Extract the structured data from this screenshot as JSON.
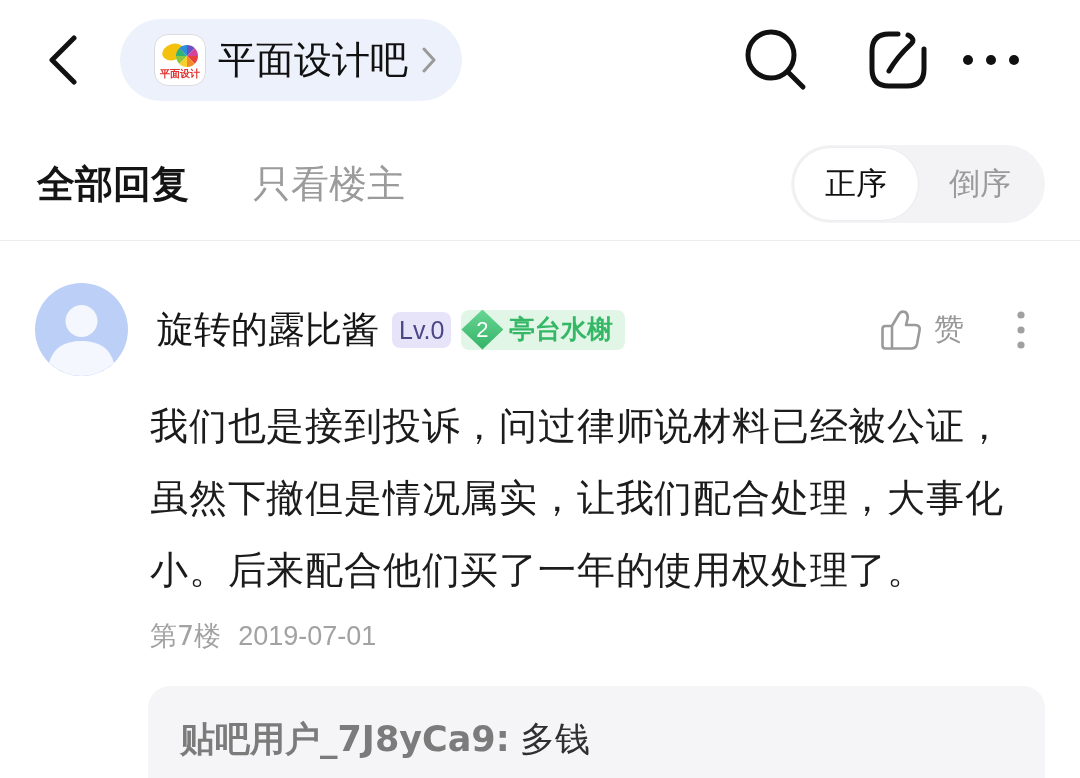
{
  "top_bar": {
    "forum": {
      "name": "平面设计吧",
      "logo_caption": "平面设计"
    }
  },
  "tabs": [
    {
      "label": "全部回复",
      "selected": true
    },
    {
      "label": "只看楼主",
      "selected": false
    }
  ],
  "sort_order": [
    {
      "label": "正序",
      "selected": true
    },
    {
      "label": "倒序",
      "selected": false
    }
  ],
  "comment": {
    "author": "旋转的露比酱",
    "level": "Lv.0",
    "rank": {
      "number": "2",
      "title": "亭台水榭"
    },
    "like_label": "赞",
    "body": "我们也是接到投诉，问过律师说材料已经被公证，虽然下撤但是情况属实，让我们配合处理，大事化小。后来配合他们买了一年的使用权处理了。",
    "floor": "第7楼",
    "date": "2019-07-01",
    "replies": [
      {
        "author": "贴吧用户_7J8yCa9:",
        "text": "多钱"
      }
    ]
  }
}
